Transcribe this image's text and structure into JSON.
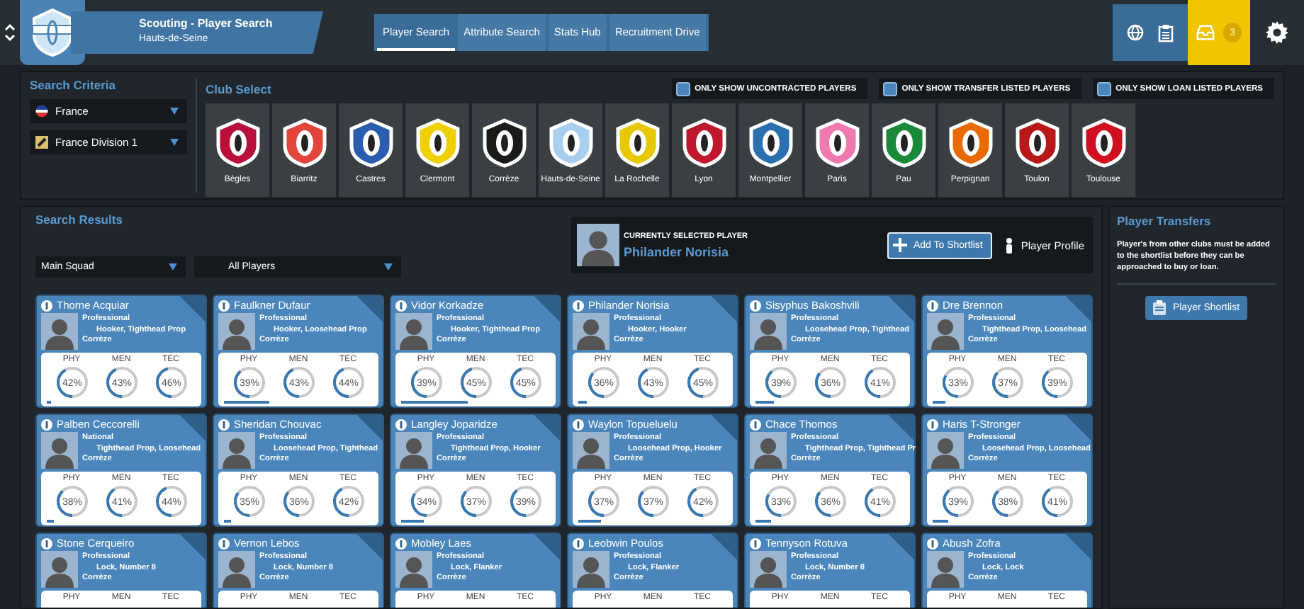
{
  "header": {
    "title": "Scouting - Player Search",
    "subtitle": "Hauts-de-Seine"
  },
  "tabs": [
    {
      "label": "Player Search",
      "selected": true
    },
    {
      "label": "Attribute Search",
      "selected": false
    },
    {
      "label": "Stats Hub",
      "selected": false
    },
    {
      "label": "Recruitment Drive",
      "selected": false
    }
  ],
  "notifications": {
    "count": "3"
  },
  "search_criteria": {
    "title": "Search Criteria",
    "dropdowns": [
      {
        "value": "France"
      },
      {
        "value": "France Division 1"
      }
    ]
  },
  "club_select": {
    "title": "Club Select",
    "filters": [
      {
        "label": "ONLY SHOW UNCONTRACTED PLAYERS",
        "checked": false
      },
      {
        "label": "ONLY SHOW TRANSFER LISTED PLAYERS",
        "checked": false
      },
      {
        "label": "ONLY SHOW LOAN LISTED PLAYERS",
        "checked": false
      }
    ],
    "clubs": [
      {
        "name": "Bègles",
        "color": "#b8103a"
      },
      {
        "name": "Biarritz",
        "color": "#e2453c"
      },
      {
        "name": "Castres",
        "color": "#2a5cb0"
      },
      {
        "name": "Clermont",
        "color": "#f0d000"
      },
      {
        "name": "Corrèze",
        "color": "#1a1a1a"
      },
      {
        "name": "Hauts-de-Seine",
        "color": "#a8d0ee"
      },
      {
        "name": "La Rochelle",
        "color": "#e8c800"
      },
      {
        "name": "Lyon",
        "color": "#c0182c"
      },
      {
        "name": "Montpellier",
        "color": "#2a6fb0"
      },
      {
        "name": "Paris",
        "color": "#f07ab0"
      },
      {
        "name": "Pau",
        "color": "#1a8a3a"
      },
      {
        "name": "Perpignan",
        "color": "#e86a00"
      },
      {
        "name": "Toulon",
        "color": "#b81818"
      },
      {
        "name": "Toulouse",
        "color": "#d01020"
      }
    ]
  },
  "search_results": {
    "title": "Search Results",
    "dropdowns": [
      {
        "value": "Main Squad"
      },
      {
        "value": "All Players"
      }
    ],
    "selected_player": {
      "caption": "CURRENTLY SELECTED PLAYER",
      "name": "Philander Norisia"
    },
    "actions": [
      {
        "label": "Add To Shortlist",
        "kind": "add"
      },
      {
        "label": "Player Profile",
        "kind": "profile"
      }
    ],
    "players": [
      {
        "name": "Thorne Acquiar",
        "status": "Professional",
        "positions": "Hooker, Tighthead Prop",
        "club": "Corrèze",
        "level": 0.03,
        "stats": [
          {
            "label": "PHY",
            "value": "42%"
          },
          {
            "label": "MEN",
            "value": "43%"
          },
          {
            "label": "TEC",
            "value": "46%"
          }
        ]
      },
      {
        "name": "Faulkner Dufaur",
        "status": "Professional",
        "positions": "Hooker, Loosehead Prop",
        "club": "Corrèze",
        "level": 0.3,
        "stats": [
          {
            "label": "PHY",
            "value": "39%"
          },
          {
            "label": "MEN",
            "value": "43%"
          },
          {
            "label": "TEC",
            "value": "44%"
          }
        ]
      },
      {
        "name": "Vidor Korkadze",
        "status": "Professional",
        "positions": "Hooker, Tighthead Prop",
        "club": "Corrèze",
        "level": 0.45,
        "stats": [
          {
            "label": "PHY",
            "value": "39%"
          },
          {
            "label": "MEN",
            "value": "45%"
          },
          {
            "label": "TEC",
            "value": "45%"
          }
        ]
      },
      {
        "name": "Philander Norisia",
        "status": "Professional",
        "positions": "Hooker, Hooker",
        "club": "Corrèze",
        "level": 0.06,
        "stats": [
          {
            "label": "PHY",
            "value": "36%"
          },
          {
            "label": "MEN",
            "value": "43%"
          },
          {
            "label": "TEC",
            "value": "45%"
          }
        ]
      },
      {
        "name": "Sisyphus Bakoshvili",
        "status": "Professional",
        "positions": "Loosehead Prop, Tighthead",
        "club": "Corrèze",
        "level": 0.12,
        "stats": [
          {
            "label": "PHY",
            "value": "39%"
          },
          {
            "label": "MEN",
            "value": "36%"
          },
          {
            "label": "TEC",
            "value": "41%"
          }
        ]
      },
      {
        "name": "Dre Brennon",
        "status": "Professional",
        "positions": "Tighthead Prop, Loosehead",
        "club": "Corrèze",
        "level": 0.09,
        "stats": [
          {
            "label": "PHY",
            "value": "33%"
          },
          {
            "label": "MEN",
            "value": "37%"
          },
          {
            "label": "TEC",
            "value": "39%"
          }
        ]
      },
      {
        "name": "Palben Ceccorelli",
        "status": "National",
        "positions": "Tighthead Prop, Loosehead",
        "club": "Corrèze",
        "level": 0.05,
        "stats": [
          {
            "label": "PHY",
            "value": "38%"
          },
          {
            "label": "MEN",
            "value": "41%"
          },
          {
            "label": "TEC",
            "value": "44%"
          }
        ]
      },
      {
        "name": "Sheridan Chouvac",
        "status": "Professional",
        "positions": "Loosehead Prop, Tighthead",
        "club": "Corrèze",
        "level": 0.05,
        "stats": [
          {
            "label": "PHY",
            "value": "35%"
          },
          {
            "label": "MEN",
            "value": "36%"
          },
          {
            "label": "TEC",
            "value": "42%"
          }
        ]
      },
      {
        "name": "Langley Joparidze",
        "status": "Professional",
        "positions": "Tighthead Prop, Hooker",
        "club": "Corrèze",
        "level": 0.15,
        "stats": [
          {
            "label": "PHY",
            "value": "34%"
          },
          {
            "label": "MEN",
            "value": "37%"
          },
          {
            "label": "TEC",
            "value": "39%"
          }
        ]
      },
      {
        "name": "Waylon Topueluelu",
        "status": "Professional",
        "positions": "Loosehead Prop, Hooker",
        "club": "Corrèze",
        "level": 0.15,
        "stats": [
          {
            "label": "PHY",
            "value": "37%"
          },
          {
            "label": "MEN",
            "value": "37%"
          },
          {
            "label": "TEC",
            "value": "42%"
          }
        ]
      },
      {
        "name": "Chace Thomos",
        "status": "Professional",
        "positions": "Tighthead Prop, Tighthead Pr",
        "club": "Corrèze",
        "level": 0.1,
        "stats": [
          {
            "label": "PHY",
            "value": "33%"
          },
          {
            "label": "MEN",
            "value": "36%"
          },
          {
            "label": "TEC",
            "value": "41%"
          }
        ]
      },
      {
        "name": "Haris T-Stronger",
        "status": "Professional",
        "positions": "Loosehead Prop, Loosehead",
        "club": "Corrèze",
        "level": 0.1,
        "stats": [
          {
            "label": "PHY",
            "value": "39%"
          },
          {
            "label": "MEN",
            "value": "38%"
          },
          {
            "label": "TEC",
            "value": "41%"
          }
        ]
      },
      {
        "name": "Stone Cerqueiro",
        "status": "Professional",
        "positions": "Lock, Number 8",
        "club": "Corrèze",
        "stats": [
          {
            "label": "PHY"
          },
          {
            "label": "MEN"
          },
          {
            "label": "TEC"
          }
        ]
      },
      {
        "name": "Vernon Lebos",
        "status": "Professional",
        "positions": "Lock, Number 8",
        "club": "Corrèze",
        "stats": [
          {
            "label": "PHY"
          },
          {
            "label": "MEN"
          },
          {
            "label": "TEC"
          }
        ]
      },
      {
        "name": "Mobley Laes",
        "status": "Professional",
        "positions": "Lock, Flanker",
        "club": "Corrèze",
        "stats": [
          {
            "label": "PHY"
          },
          {
            "label": "MEN"
          },
          {
            "label": "TEC"
          }
        ]
      },
      {
        "name": "Leobwin Poulos",
        "status": "Professional",
        "positions": "Lock, Flanker",
        "club": "Corrèze",
        "stats": [
          {
            "label": "PHY"
          },
          {
            "label": "MEN"
          },
          {
            "label": "TEC"
          }
        ]
      },
      {
        "name": "Tennyson Rotuva",
        "status": "Professional",
        "positions": "Lock, Number 8",
        "club": "Corrèze",
        "stats": [
          {
            "label": "PHY"
          },
          {
            "label": "MEN"
          },
          {
            "label": "TEC"
          }
        ]
      },
      {
        "name": "Abush Zofra",
        "status": "Professional",
        "positions": "Lock, Lock",
        "club": "Corrèze",
        "stats": [
          {
            "label": "PHY"
          },
          {
            "label": "MEN"
          },
          {
            "label": "TEC"
          }
        ]
      }
    ]
  },
  "player_transfers": {
    "title": "Player Transfers",
    "note": "Player's from other clubs must be added to the shortlist before they can be approached to buy or loan.",
    "button": "Player Shortlist"
  }
}
